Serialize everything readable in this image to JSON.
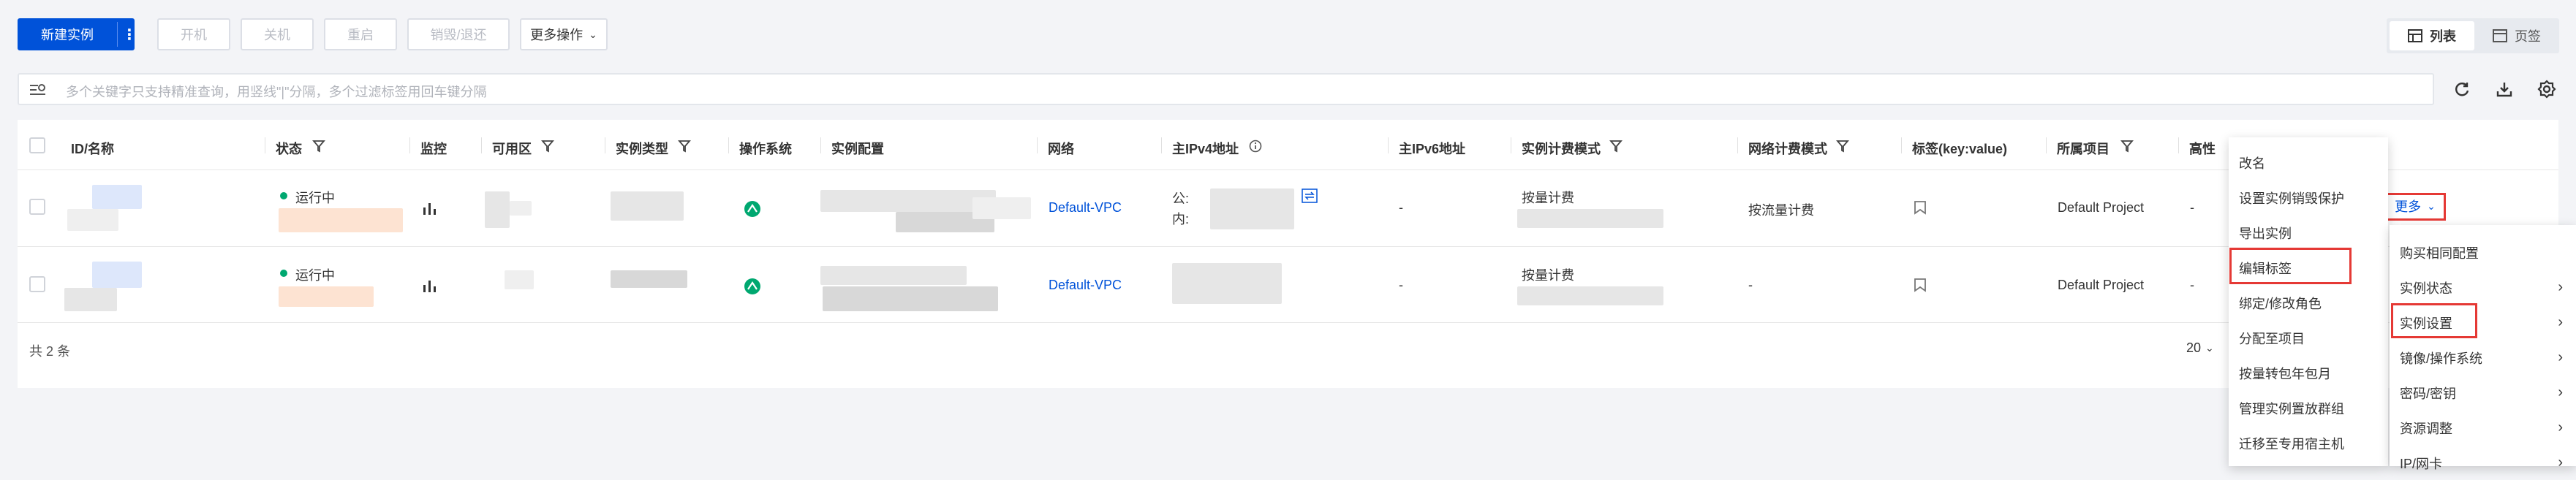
{
  "toolbar": {
    "new_instance": "新建实例",
    "new_instance_more": "⋮",
    "start": "开机",
    "shutdown": "关机",
    "restart": "重启",
    "destroy": "销毁/退还",
    "more_ops": "更多操作",
    "view_list": "列表",
    "view_tab": "页签"
  },
  "search": {
    "placeholder": "多个关键字只支持精准查询，用竖线\"|\"分隔，多个过滤标签用回车键分隔"
  },
  "table": {
    "columns": [
      "ID/名称",
      "状态",
      "监控",
      "可用区",
      "实例类型",
      "操作系统",
      "实例配置",
      "网络",
      "主IPv4地址",
      "主IPv6地址",
      "实例计费模式",
      "网络计费模式",
      "标签(key:value)",
      "所属项目",
      "高性"
    ],
    "rows": [
      {
        "status": "运行中",
        "network": "Default-VPC",
        "ipv4_public_prefix": "公:",
        "ipv4_private_prefix": "内:",
        "ipv6": "-",
        "billing": "按量计费",
        "net_billing": "按流量计费",
        "project": "Default Project",
        "dash": "-",
        "more": "更多"
      },
      {
        "status": "运行中",
        "network": "Default-VPC",
        "ipv6": "-",
        "billing": "按量计费",
        "net_billing": "-",
        "project": "Default Project",
        "dash": "-"
      }
    ],
    "total": "共 2 条",
    "page_size": "20"
  },
  "more_menu": {
    "items": [
      "改名",
      "设置实例销毁保护",
      "导出实例",
      "编辑标签",
      "绑定/修改角色",
      "分配至项目",
      "按量转包年包月",
      "管理实例置放群组",
      "迁移至专用宿主机"
    ]
  },
  "ops_menu": {
    "items": [
      "购买相同配置",
      "实例状态",
      "实例设置",
      "镜像/操作系统",
      "密码/密钥",
      "资源调整",
      "IP/网卡"
    ]
  },
  "colors": {
    "primary": "#0052d9",
    "running": "#00a870",
    "highlight": "#e53935"
  }
}
